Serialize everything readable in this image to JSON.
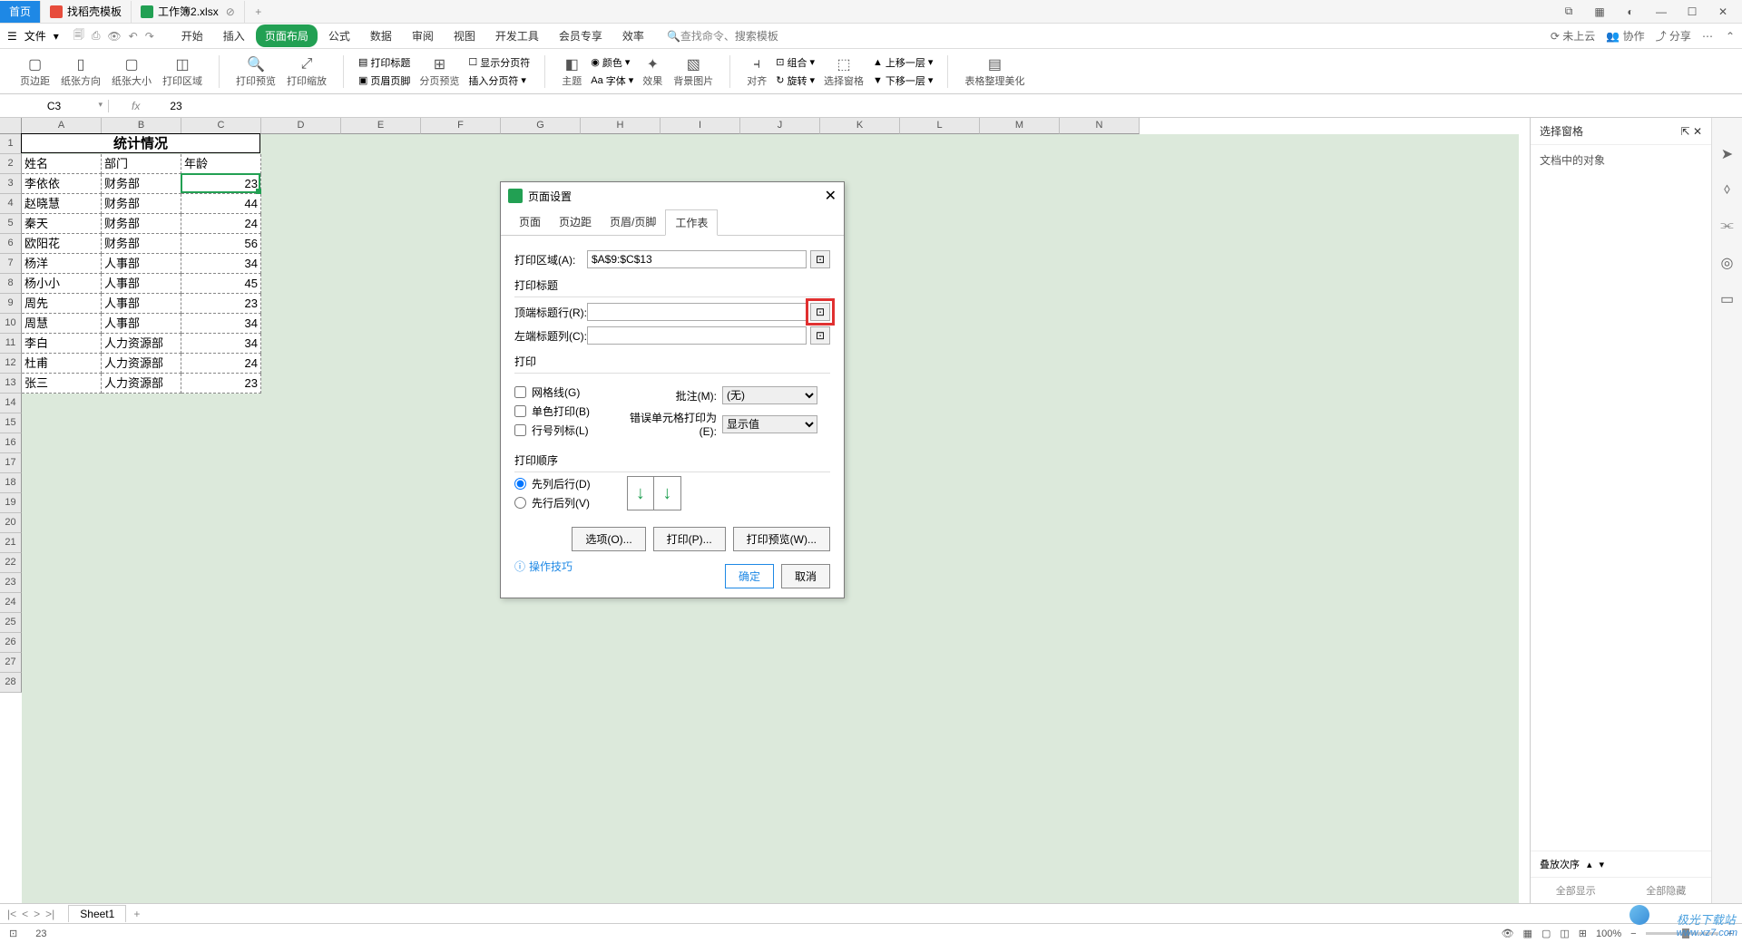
{
  "titlebar": {
    "home": "首页",
    "tab1": "找稻壳模板",
    "tab2": "工作簿2.xlsx",
    "add": "+"
  },
  "menubar": {
    "file": "文件",
    "tabs": [
      "开始",
      "插入",
      "页面布局",
      "公式",
      "数据",
      "审阅",
      "视图",
      "开发工具",
      "会员专享",
      "效率"
    ],
    "active_idx": 2,
    "search_label": "查找命令、",
    "search_placeholder": "搜索模板",
    "cloud": "未上云",
    "coop": "协作",
    "share": "分享"
  },
  "ribbon": {
    "r1": "页边距",
    "r2": "纸张方向",
    "r3": "纸张大小",
    "r4": "打印区域",
    "r5": "打印预览",
    "r6": "打印缩放",
    "r7": "打印标题",
    "r8": "页眉页脚",
    "r9": "分页预览",
    "r10": "显示分页符",
    "r11": "插入分页符",
    "r12": "主题",
    "r13": "颜色",
    "r14": "字体",
    "r15": "效果",
    "r16": "背景图片",
    "r17": "对齐",
    "r18": "组合",
    "r19": "旋转",
    "r20": "选择窗格",
    "r21": "上移一层",
    "r22": "下移一层",
    "r23": "表格整理美化"
  },
  "formula": {
    "name": "C3",
    "fx": "fx",
    "value": "23"
  },
  "cols": [
    "A",
    "B",
    "C",
    "D",
    "E",
    "F",
    "G",
    "H",
    "I",
    "J",
    "K",
    "L",
    "M",
    "N"
  ],
  "rows_max": 28,
  "table": {
    "title": "统计情况",
    "h1": "姓名",
    "h2": "部门",
    "h3": "年龄",
    "rows": [
      {
        "a": "李依依",
        "b": "财务部",
        "c": "23"
      },
      {
        "a": "赵晓慧",
        "b": "财务部",
        "c": "44"
      },
      {
        "a": "秦天",
        "b": "财务部",
        "c": "24"
      },
      {
        "a": "欧阳花",
        "b": "财务部",
        "c": "56"
      },
      {
        "a": "杨洋",
        "b": "人事部",
        "c": "34"
      },
      {
        "a": "杨小小",
        "b": "人事部",
        "c": "45"
      },
      {
        "a": "周先",
        "b": "人事部",
        "c": "23"
      },
      {
        "a": "周慧",
        "b": "人事部",
        "c": "34"
      },
      {
        "a": "李白",
        "b": "人力资源部",
        "c": "34"
      },
      {
        "a": "杜甫",
        "b": "人力资源部",
        "c": "24"
      },
      {
        "a": "张三",
        "b": "人力资源部",
        "c": "23"
      }
    ]
  },
  "dialog": {
    "title": "页面设置",
    "tabs": [
      "页面",
      "页边距",
      "页眉/页脚",
      "工作表"
    ],
    "active_tab": 3,
    "print_area_label": "打印区域(A):",
    "print_area_value": "$A$9:$C$13",
    "print_titles": "打印标题",
    "top_row_label": "顶端标题行(R):",
    "left_col_label": "左端标题列(C):",
    "print": "打印",
    "gridlines": "网格线(G)",
    "mono": "单色打印(B)",
    "rowcol": "行号列标(L)",
    "comments_label": "批注(M):",
    "comments_value": "(无)",
    "errors_label": "错误单元格打印为(E):",
    "errors_value": "显示值",
    "order": "打印顺序",
    "order1": "先列后行(D)",
    "order2": "先行后列(V)",
    "btn_opt": "选项(O)...",
    "btn_print": "打印(P)...",
    "btn_preview": "打印预览(W)...",
    "tips": "操作技巧",
    "ok": "确定",
    "cancel": "取消"
  },
  "pane": {
    "title": "选择窗格",
    "sub": "文档中的对象",
    "stack": "叠放次序",
    "show_all": "全部显示",
    "hide_all": "全部隐藏"
  },
  "sheet": {
    "name": "Sheet1",
    "add": "+"
  },
  "status": {
    "val": "23",
    "zoom": "100%"
  },
  "watermark": {
    "line1": "极光下载站",
    "line2": "www.xz7.com"
  }
}
